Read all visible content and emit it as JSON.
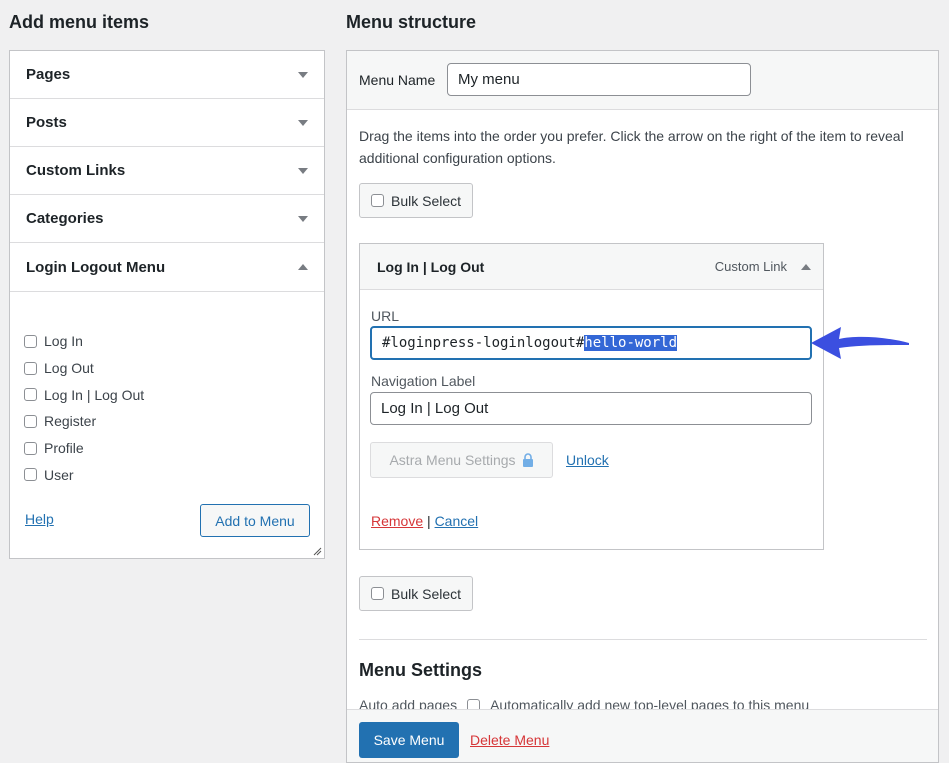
{
  "left": {
    "title": "Add menu items",
    "sections": [
      "Pages",
      "Posts",
      "Custom Links",
      "Categories"
    ],
    "open_section": "Login Logout Menu",
    "items": [
      "Log In",
      "Log Out",
      "Log In | Log Out",
      "Register",
      "Profile",
      "User"
    ],
    "help": "Help",
    "add_button": "Add to Menu"
  },
  "right": {
    "title": "Menu structure",
    "menu_name_label": "Menu Name",
    "menu_name": "My menu",
    "instructions": "Drag the items into the order you prefer. Click the arrow on the right of the item to reveal additional configuration options.",
    "bulk_select": "Bulk Select",
    "item": {
      "title": "Log In | Log Out",
      "type": "Custom Link",
      "url_label": "URL",
      "url_prefix": "#loginpress-loginlogout#",
      "url_selected": "hello-world",
      "nav_label_label": "Navigation Label",
      "nav_label": "Log In | Log Out",
      "astra_button": "Astra Menu Settings",
      "unlock": "Unlock",
      "remove": "Remove",
      "separator": "|",
      "cancel": "Cancel"
    },
    "settings_title": "Menu Settings",
    "auto_add_label": "Auto add pages",
    "auto_add_text": "Automatically add new top-level pages to this menu",
    "save": "Save Menu",
    "delete": "Delete Menu"
  },
  "colors": {
    "accent": "#2271b1",
    "danger": "#d63638",
    "arrow": "#3b4fe0",
    "selection": "#3367d6"
  }
}
